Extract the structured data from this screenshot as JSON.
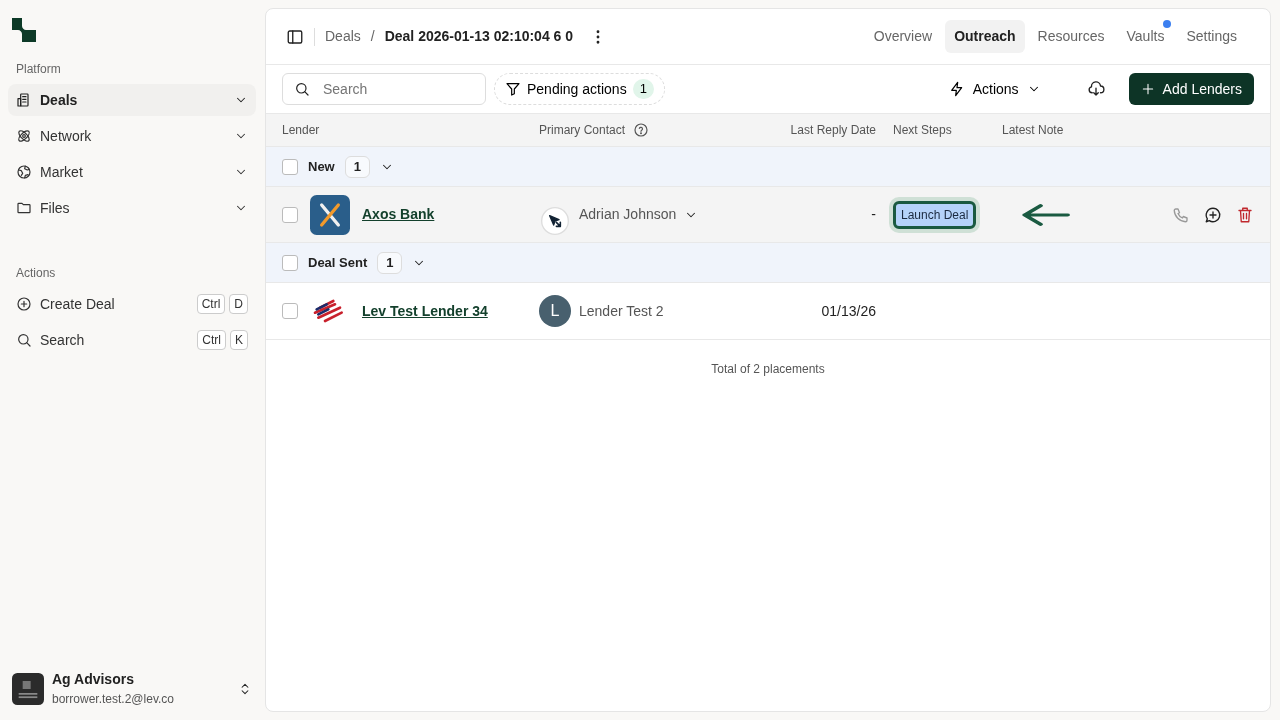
{
  "sidebar": {
    "sections": [
      {
        "title": "Platform",
        "items": [
          {
            "label": "Deals",
            "selected": true
          },
          {
            "label": "Network",
            "selected": false
          },
          {
            "label": "Market",
            "selected": false
          },
          {
            "label": "Files",
            "selected": false
          }
        ]
      },
      {
        "title": "Actions",
        "items": [
          {
            "label": "Create Deal",
            "shortcut": [
              "Ctrl",
              "D"
            ]
          },
          {
            "label": "Search",
            "shortcut": [
              "Ctrl",
              "K"
            ]
          }
        ]
      }
    ],
    "account": {
      "name": "Ag Advisors",
      "email": "borrower.test.2@lev.co"
    }
  },
  "header": {
    "breadcrumb": "Deals",
    "separator": "/",
    "title": "Deal 2026-01-13 02:10:04 6 0",
    "tabs": [
      {
        "label": "Overview",
        "selected": false,
        "dot": false
      },
      {
        "label": "Outreach",
        "selected": true,
        "dot": false
      },
      {
        "label": "Resources",
        "selected": false,
        "dot": false
      },
      {
        "label": "Vaults",
        "selected": false,
        "dot": true
      },
      {
        "label": "Settings",
        "selected": false,
        "dot": false
      }
    ]
  },
  "toolbar": {
    "search": {
      "placeholder": "Search"
    },
    "filter": {
      "label": "Pending actions",
      "count": "1"
    },
    "actions": "Actions",
    "add": "Add Lenders"
  },
  "table": {
    "columns": [
      "Lender",
      "Primary Contact",
      "Last Reply Date",
      "Next Steps",
      "Latest Note"
    ],
    "groups": [
      {
        "label": "New",
        "count": "1",
        "checked": false,
        "rows": [
          {
            "lender": "Axos Bank",
            "contact": "Adrian Johnson",
            "avatar": null,
            "dropdown": true,
            "last_reply": "-",
            "next_step": "Launch Deal",
            "next_step_focused": true,
            "hovered": true,
            "checked": false
          }
        ]
      },
      {
        "label": "Deal Sent",
        "count": "1",
        "checked": false,
        "rows": [
          {
            "lender": "Lev Test Lender 34",
            "contact": "Lender Test 2",
            "avatar": "L",
            "dropdown": false,
            "last_reply": "01/13/26",
            "next_step": null,
            "next_step_focused": false,
            "hovered": false,
            "checked": false
          }
        ]
      }
    ],
    "footer": "Total of 2 placements"
  }
}
